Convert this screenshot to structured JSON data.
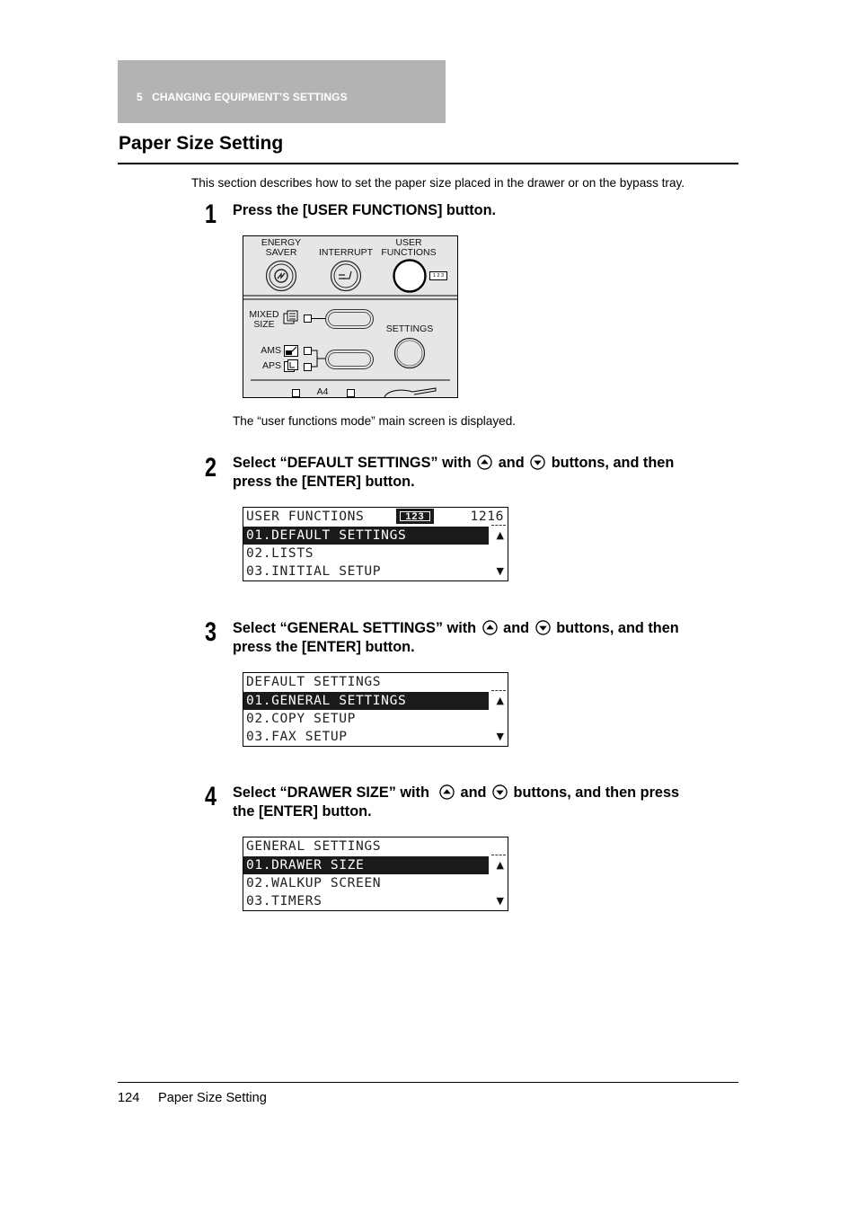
{
  "chapter": {
    "number": "5",
    "title": "CHANGING EQUIPMENT’S SETTINGS"
  },
  "page_title": "Paper Size Setting",
  "intro": "This section describes how to set the paper size placed in the drawer or on the bypass tray.",
  "steps": [
    {
      "number": "1",
      "lines": [
        "Press the [USER FUNCTIONS] button."
      ],
      "note": "The “user functions mode” main screen is displayed."
    },
    {
      "number": "2",
      "pre": "Select “DEFAULT SETTINGS” with",
      "and": "and",
      "post": "buttons, and then",
      "line2": "press the [ENTER] button."
    },
    {
      "number": "3",
      "pre": "Select “GENERAL SETTINGS” with",
      "and": "and",
      "post": "buttons, and then",
      "line2": "press the [ENTER] button."
    },
    {
      "number": "4",
      "pre": "Select “DRAWER SIZE” with",
      "and": "and",
      "post": "buttons, and then press",
      "line2": "the [ENTER] button."
    }
  ],
  "control_panel": {
    "energy_saver": "ENERGY\nSAVER",
    "energy_saver_l1": "ENERGY",
    "energy_saver_l2": "SAVER",
    "interrupt": "INTERRUPT",
    "user_functions_l1": "USER",
    "user_functions_l2": "FUNCTIONS",
    "mini_badge": "1 2 3",
    "mixed_size_l1": "MIXED",
    "mixed_size_l2": "SIZE",
    "settings": "SETTINGS",
    "ams": "AMS",
    "aps": "APS",
    "paper_size": "A4"
  },
  "screens": [
    {
      "header": "USER FUNCTIONS",
      "badge": "123",
      "counter": "1216",
      "items": [
        "01.DEFAULT SETTINGS",
        "02.LISTS",
        "03.INITIAL SETUP"
      ],
      "selected_index": 0
    },
    {
      "header": "DEFAULT SETTINGS",
      "items": [
        "01.GENERAL SETTINGS",
        "02.COPY SETUP",
        "03.FAX SETUP"
      ],
      "selected_index": 0
    },
    {
      "header": "GENERAL SETTINGS",
      "items": [
        "01.DRAWER SIZE",
        "02.WALKUP SCREEN",
        "03.TIMERS"
      ],
      "selected_index": 0
    }
  ],
  "scroll_icons": {
    "up": "▲",
    "down": "▼"
  },
  "footer": {
    "page_number": "124",
    "section_title": "Paper Size Setting"
  }
}
